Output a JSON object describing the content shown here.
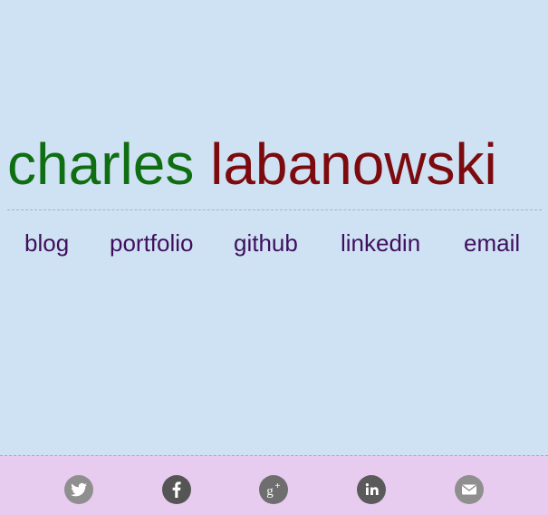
{
  "header": {
    "first_name": "charles",
    "last_name": "labanowski",
    "first_color": "#106e12",
    "last_color": "#7d0a0e"
  },
  "nav": {
    "items": [
      {
        "label": "blog"
      },
      {
        "label": "portfolio"
      },
      {
        "label": "github"
      },
      {
        "label": "linkedin"
      },
      {
        "label": "email"
      }
    ],
    "link_color": "#3f0f5e"
  },
  "footer": {
    "background": "#e8ccf0",
    "icons": [
      {
        "name": "twitter-icon",
        "color": "#8f8f8f"
      },
      {
        "name": "facebook-icon",
        "color": "#555555"
      },
      {
        "name": "google-plus-icon",
        "color": "#6e6e6e"
      },
      {
        "name": "linkedin-icon",
        "color": "#5a5a5a"
      },
      {
        "name": "email-icon",
        "color": "#8f8f8f"
      }
    ]
  },
  "page": {
    "background": "#cfe2f3"
  }
}
